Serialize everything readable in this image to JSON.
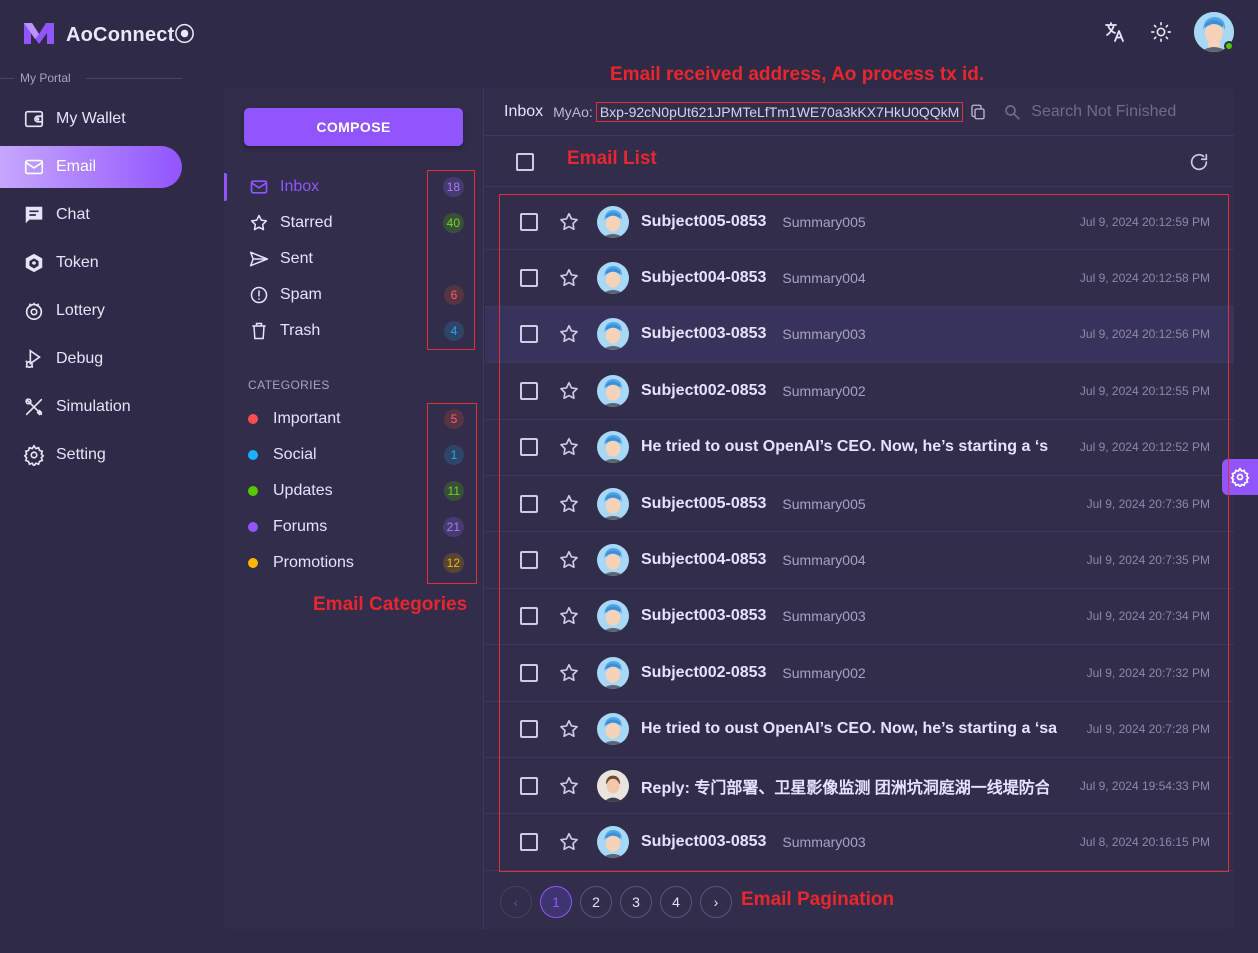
{
  "app": {
    "name": "AoConnect⦿"
  },
  "header": {
    "translate_icon": "translate-icon",
    "theme_icon": "sun-icon"
  },
  "sidebar": {
    "section_label": "My Portal",
    "items": [
      {
        "label": "My Wallet",
        "icon": "wallet-icon",
        "active": false
      },
      {
        "label": "Email",
        "icon": "mail-icon",
        "active": true
      },
      {
        "label": "Chat",
        "icon": "chat-icon",
        "active": false
      },
      {
        "label": "Token",
        "icon": "token-icon",
        "active": false
      },
      {
        "label": "Lottery",
        "icon": "lottery-icon",
        "active": false
      },
      {
        "label": "Debug",
        "icon": "bug-icon",
        "active": false
      },
      {
        "label": "Simulation",
        "icon": "tools-icon",
        "active": false
      },
      {
        "label": "Setting",
        "icon": "gear-icon",
        "active": false
      }
    ]
  },
  "mail": {
    "compose_label": "COMPOSE",
    "folders": [
      {
        "label": "Inbox",
        "count": "18",
        "badge_color": "purple",
        "active": true
      },
      {
        "label": "Starred",
        "count": "40",
        "badge_color": "green",
        "active": false
      },
      {
        "label": "Sent",
        "count": "",
        "badge_color": "",
        "active": false
      },
      {
        "label": "Spam",
        "count": "6",
        "badge_color": "red",
        "active": false
      },
      {
        "label": "Trash",
        "count": "4",
        "badge_color": "blue",
        "active": false
      }
    ],
    "categories_title": "CATEGORIES",
    "categories": [
      {
        "label": "Important",
        "count": "5",
        "color": "#ff4c51"
      },
      {
        "label": "Social",
        "count": "1",
        "color": "#16b1ff"
      },
      {
        "label": "Updates",
        "count": "11",
        "color": "#56ca00"
      },
      {
        "label": "Forums",
        "count": "21",
        "color": "#9155fd"
      },
      {
        "label": "Promotions",
        "count": "12",
        "color": "#ffb400"
      }
    ],
    "inbox_title": "Inbox",
    "address_label": "MyAo:",
    "address": "Bxp-92cN0pUt621JPMTeLfTm1WE70a3kKX7HkU0QQkM",
    "search_placeholder": "Search Not Finished",
    "emails": [
      {
        "subject": "Subject005-0853",
        "summary": "Summary005",
        "time": "Jul 9, 2024 20:12:59 PM",
        "avatar": "blue"
      },
      {
        "subject": "Subject004-0853",
        "summary": "Summary004",
        "time": "Jul 9, 2024 20:12:58 PM",
        "avatar": "blue"
      },
      {
        "subject": "Subject003-0853",
        "summary": "Summary003",
        "time": "Jul 9, 2024 20:12:56 PM",
        "avatar": "blue"
      },
      {
        "subject": "Subject002-0853",
        "summary": "Summary002",
        "time": "Jul 9, 2024 20:12:55 PM",
        "avatar": "blue"
      },
      {
        "subject": "He tried to oust OpenAI’s CEO. Now, he’s starting a ‘s",
        "summary": "",
        "time": "Jul 9, 2024 20:12:52 PM",
        "avatar": "blue"
      },
      {
        "subject": "Subject005-0853",
        "summary": "Summary005",
        "time": "Jul 9, 2024 20:7:36 PM",
        "avatar": "blue"
      },
      {
        "subject": "Subject004-0853",
        "summary": "Summary004",
        "time": "Jul 9, 2024 20:7:35 PM",
        "avatar": "blue"
      },
      {
        "subject": "Subject003-0853",
        "summary": "Summary003",
        "time": "Jul 9, 2024 20:7:34 PM",
        "avatar": "blue"
      },
      {
        "subject": "Subject002-0853",
        "summary": "Summary002",
        "time": "Jul 9, 2024 20:7:32 PM",
        "avatar": "blue"
      },
      {
        "subject": "He tried to oust OpenAI’s CEO. Now, he’s starting a ‘sa",
        "summary": "",
        "time": "Jul 9, 2024 20:7:28 PM",
        "avatar": "blue"
      },
      {
        "subject": "Reply: 专门部署、卫星影像监测 团洲坑洞庭湖一线堤防合",
        "summary": "",
        "time": "Jul 9, 2024 19:54:33 PM",
        "avatar": "person"
      },
      {
        "subject": "Subject003-0853",
        "summary": "Summary003",
        "time": "Jul 8, 2024 20:16:15 PM",
        "avatar": "blue"
      }
    ],
    "pagination": {
      "pages": [
        "1",
        "2",
        "3",
        "4"
      ],
      "current": "1",
      "prev": "‹",
      "next": "›"
    }
  },
  "annotations": {
    "address_note": "Email received address, Ao process tx id.",
    "list_note": "Email List",
    "categories_note": "Email Categories",
    "pagination_note": "Email Pagination"
  }
}
